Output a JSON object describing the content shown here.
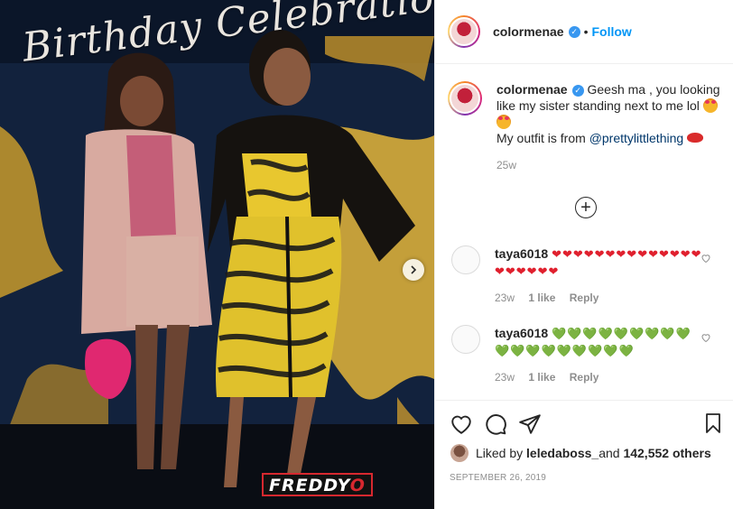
{
  "photo": {
    "banner_text": "Birthday Celebration",
    "watermark_prefix": "FREDDY",
    "watermark_suffix": "O",
    "next_icon": "chevron-right-icon"
  },
  "header": {
    "username": "colormenae",
    "separator": "•",
    "follow_label": "Follow"
  },
  "caption": {
    "username": "colormenae",
    "text_line1": "Geesh ma , you looking like my sister standing next to me lol",
    "text_line2_prefix": "My outfit is from ",
    "mention": "@prettylittlething",
    "time": "25w"
  },
  "load_more_icon": "plus-circle-icon",
  "comments": [
    {
      "username": "taya6018",
      "hearts": "❤❤❤❤❤❤❤❤❤❤❤❤❤❤❤❤❤❤❤❤",
      "heart_color": "#e0202e",
      "time": "23w",
      "likes": "1 like",
      "reply": "Reply"
    },
    {
      "username": "taya6018",
      "hearts": "💚💚💚💚💚💚💚💚💚💚💚💚💚💚💚💚💚💚",
      "heart_color": "#25b728",
      "time": "23w",
      "likes": "1 like",
      "reply": "Reply"
    }
  ],
  "likes": {
    "prefix": "Liked by ",
    "user": "leledaboss_",
    "middle": " and ",
    "count": "142,552 others"
  },
  "date": "SEPTEMBER 26, 2019",
  "colors": {
    "link_blue": "#0095f6",
    "mention": "#00376b",
    "muted": "#8e8e8e"
  }
}
